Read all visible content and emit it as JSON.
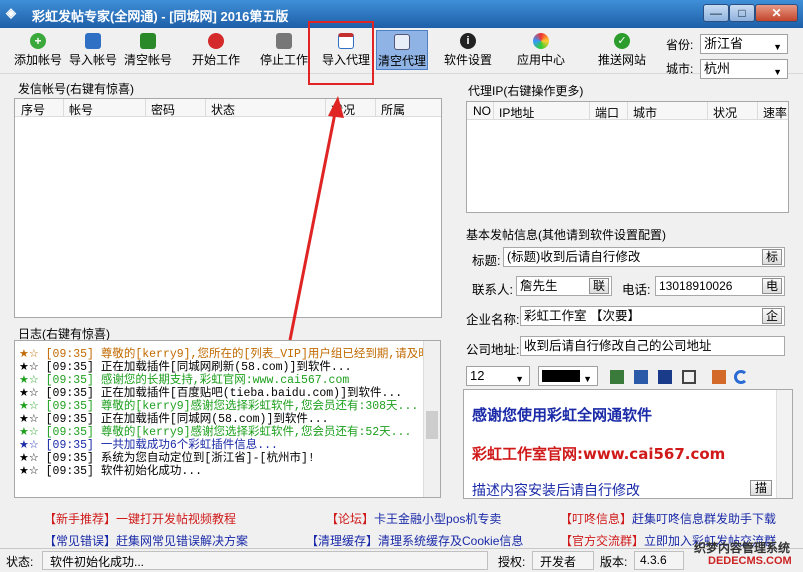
{
  "window": {
    "title": "彩虹发帖专家(全网通) - [同城网]   2016第五版",
    "icon": "rainbow-app-icon",
    "controls": {
      "minimize": "—",
      "maximize": "□",
      "close": "✕"
    }
  },
  "toolbar": {
    "add_account": "添加帐号",
    "import_account": "导入帐号",
    "clear_account": "清空帐号",
    "start_work": "开始工作",
    "stop_work": "停止工作",
    "import_proxy": "导入代理",
    "clear_proxy": "清空代理",
    "software_settings": "软件设置",
    "app_center": "应用中心",
    "push_site": "推送网站",
    "province_label": "省份:",
    "province_value": "浙江省",
    "city_label": "城市:",
    "city_value": "杭州"
  },
  "accounts": {
    "label": "发信帐号(右键有惊喜)",
    "columns": [
      "序号",
      "帐号",
      "密码",
      "状态",
      "状况",
      "所属"
    ]
  },
  "proxy": {
    "label": "代理IP(右键操作更多)",
    "columns": [
      "NO",
      "IP地址",
      "端口",
      "城市",
      "状况",
      "速率"
    ]
  },
  "post_info": {
    "label": "基本发帖信息(其他请到软件设置配置)",
    "title_label": "标题:",
    "title_value": "(标题)收到后请自行修改",
    "title_button": "标",
    "contact_label": "联系人:",
    "contact_value": "詹先生",
    "contact_button": "联",
    "phone_label": "电话:",
    "phone_value": "13018910026",
    "phone_button": "电",
    "company_label": "企业名称:",
    "company_value": "彩虹工作室    【次要】",
    "company_button": "企",
    "address_label": "公司地址:",
    "address_value": "收到后请自行修改自己的公司地址"
  },
  "editor": {
    "font_size": "12",
    "line1": "感谢您使用彩虹全网通软件",
    "line2": "彩虹工作室官网:www.cai567.com",
    "line3": "描述内容安装后请自行修改",
    "desc_button": "描",
    "colors": {
      "line1": "#1a2aa8",
      "line2": "#d01a1a",
      "line3": "#1a2aa8"
    }
  },
  "log": {
    "label": "日志(右键有惊喜)",
    "lines": [
      {
        "star": "★☆",
        "text": "[09:35] 尊敬的[kerry9],您所在的[列表_VIP]用户组已经到期,请及时",
        "color": "#c06a00"
      },
      {
        "star": "★☆",
        "text": "[09:35] 正在加载插件[同城网刷新(58.com)]到软件...",
        "color": "#000000"
      },
      {
        "star": "★☆",
        "text": "[09:35] 感谢您的长期支持,彩虹官网:www.cai567.com",
        "color": "#1fa01f"
      },
      {
        "star": "★☆",
        "text": "[09:35] 正在加载插件[百度贴吧(tieba.baidu.com)]到软件...",
        "color": "#000000"
      },
      {
        "star": "★☆",
        "text": "[09:35] 尊敬的[kerry9]感谢您选择彩虹软件,您会员还有:308天...",
        "color": "#1fa01f"
      },
      {
        "star": "★☆",
        "text": "[09:35] 正在加载插件[同城网(58.com)]到软件...",
        "color": "#000000"
      },
      {
        "star": "★☆",
        "text": "[09:35] 尊敬的[kerry9]感谢您选择彩虹软件,您会员还有:52天...",
        "color": "#1fa01f"
      },
      {
        "star": "★☆",
        "text": "[09:35] 一共加载成功6个彩虹插件信息...",
        "color": "#1a2aa8"
      },
      {
        "star": "★☆",
        "text": "[09:35] 系统为您自动定位到[浙江省]-[杭州市]!",
        "color": "#000000"
      },
      {
        "star": "★☆",
        "text": "[09:35] 软件初始化成功...",
        "color": "#000000"
      }
    ]
  },
  "links": {
    "l1_key": "【新手推荐】",
    "l1_val": "一键打开发帖视频教程",
    "l2_key": "【论坛】",
    "l2_val": "卡王金融小型pos机专卖",
    "l3_key": "【叮咚信息】",
    "l3_val": "赶集叮咚信息群发助手下载",
    "l4_key": "【常见错误】",
    "l4_val": "赶集网常见错误解决方案",
    "l5_key": "【清理缓存】",
    "l5_val": "清理系统缓存及Cookie信息",
    "l6_key": "【官方交流群】",
    "l6_val": "立即加入彩虹发帖交流群"
  },
  "statusbar": {
    "status_label": "状态:",
    "status_value": "软件初始化成功...",
    "auth_label": "授权:",
    "auth_value": "开发者",
    "version_label": "版本:",
    "version_value": "4.3.6",
    "watermark": "织梦内容管理系统",
    "watermark_sub": "DEDECMS.COM"
  }
}
